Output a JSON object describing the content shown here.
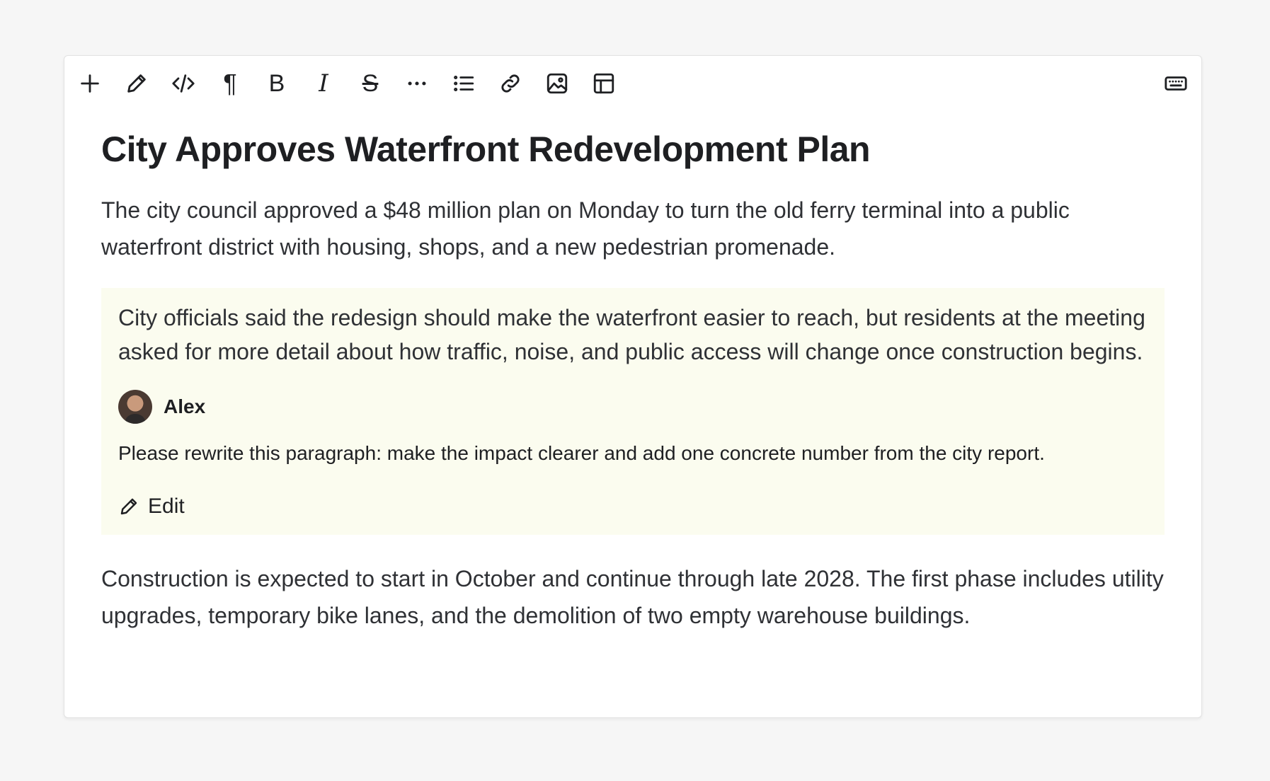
{
  "toolbar": {
    "icons": [
      "plus-icon",
      "pencil-icon",
      "code-icon",
      "paragraph-icon",
      "bold-icon",
      "italic-icon",
      "strikethrough-icon",
      "more-icon",
      "list-icon",
      "link-icon",
      "image-icon",
      "table-icon",
      "keyboard-icon"
    ],
    "paragraph_glyph": "¶",
    "bold_glyph": "B",
    "italic_glyph": "I",
    "strike_glyph": "S"
  },
  "document": {
    "title": "City Approves Waterfront Redevelopment Plan",
    "intro": "The city council approved a $48 million plan on Monday to turn the old ferry terminal into a public waterfront district with housing, shops, and a new pedestrian promenade.",
    "highlighted": "City officials said the redesign should make the waterfront easier to reach, but residents at the meeting asked for more detail about how traffic, noise, and public access will change once construction begins.",
    "closing": "Construction is expected to start in October and continue through late 2028. The first phase includes utility upgrades, temporary bike lanes, and the demolition of two empty warehouse buildings."
  },
  "comment": {
    "author": "Alex",
    "text": "Please rewrite this paragraph: make the impact clearer and add one concrete number from the city report.",
    "edit_label": "Edit"
  },
  "colors": {
    "page_bg": "#f6f6f6",
    "highlight_bg": "#fbfcef",
    "text": "#2f3135"
  }
}
